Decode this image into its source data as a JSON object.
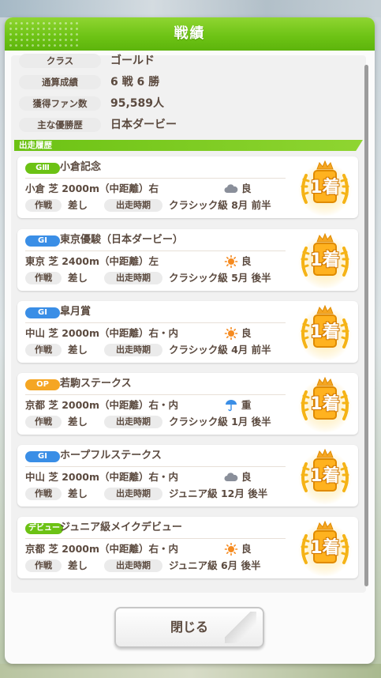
{
  "dialog": {
    "title": "戦績",
    "close_label": "閉じる"
  },
  "summary": [
    {
      "label": "クラス",
      "value": "ゴールド"
    },
    {
      "label": "通算成績",
      "value": "6 戦 6 勝"
    },
    {
      "label": "獲得ファン数",
      "value": "95,589人"
    },
    {
      "label": "主な優勝歴",
      "value": "日本ダービー"
    }
  ],
  "section_title": "出走履歴",
  "labels": {
    "tactic": "作戦",
    "period": "出走時期"
  },
  "races": [
    {
      "grade": "GⅢ",
      "grade_color": "#6cc214",
      "name": "小倉記念",
      "course": "小倉 芝 2000m（中距離）右",
      "weather_icon": "cloud-icon",
      "weather": "良",
      "tactic": "差し",
      "period": "クラシック級 8月 前半",
      "placing": "1着"
    },
    {
      "grade": "GⅠ",
      "grade_color": "#3a8ee6",
      "name": "東京優駿（日本ダービー）",
      "course": "東京 芝 2400m（中距離）左",
      "weather_icon": "sun-icon",
      "weather": "良",
      "tactic": "差し",
      "period": "クラシック級 5月 後半",
      "placing": "1着"
    },
    {
      "grade": "GⅠ",
      "grade_color": "#3a8ee6",
      "name": "皐月賞",
      "course": "中山 芝 2000m（中距離）右・内",
      "weather_icon": "sun-icon",
      "weather": "良",
      "tactic": "差し",
      "period": "クラシック級 4月 前半",
      "placing": "1着"
    },
    {
      "grade": "OP",
      "grade_color": "#f5a623",
      "name": "若駒ステークス",
      "course": "京都 芝 2000m（中距離）右・内",
      "weather_icon": "umbrella-icon",
      "weather": "重",
      "tactic": "差し",
      "period": "クラシック級 1月 後半",
      "placing": "1着"
    },
    {
      "grade": "GⅠ",
      "grade_color": "#3a8ee6",
      "name": "ホープフルステークス",
      "course": "中山 芝 2000m（中距離）右・内",
      "weather_icon": "cloud-icon",
      "weather": "良",
      "tactic": "差し",
      "period": "ジュニア級 12月 後半",
      "placing": "1着"
    },
    {
      "grade": "デビュー",
      "grade_color": "#6cc214",
      "name": "ジュニア級メイクデビュー",
      "course": "京都 芝 2000m（中距離）右・内",
      "weather_icon": "sun-icon",
      "weather": "良",
      "tactic": "差し",
      "period": "ジュニア級 6月 後半",
      "placing": "1着"
    }
  ]
}
